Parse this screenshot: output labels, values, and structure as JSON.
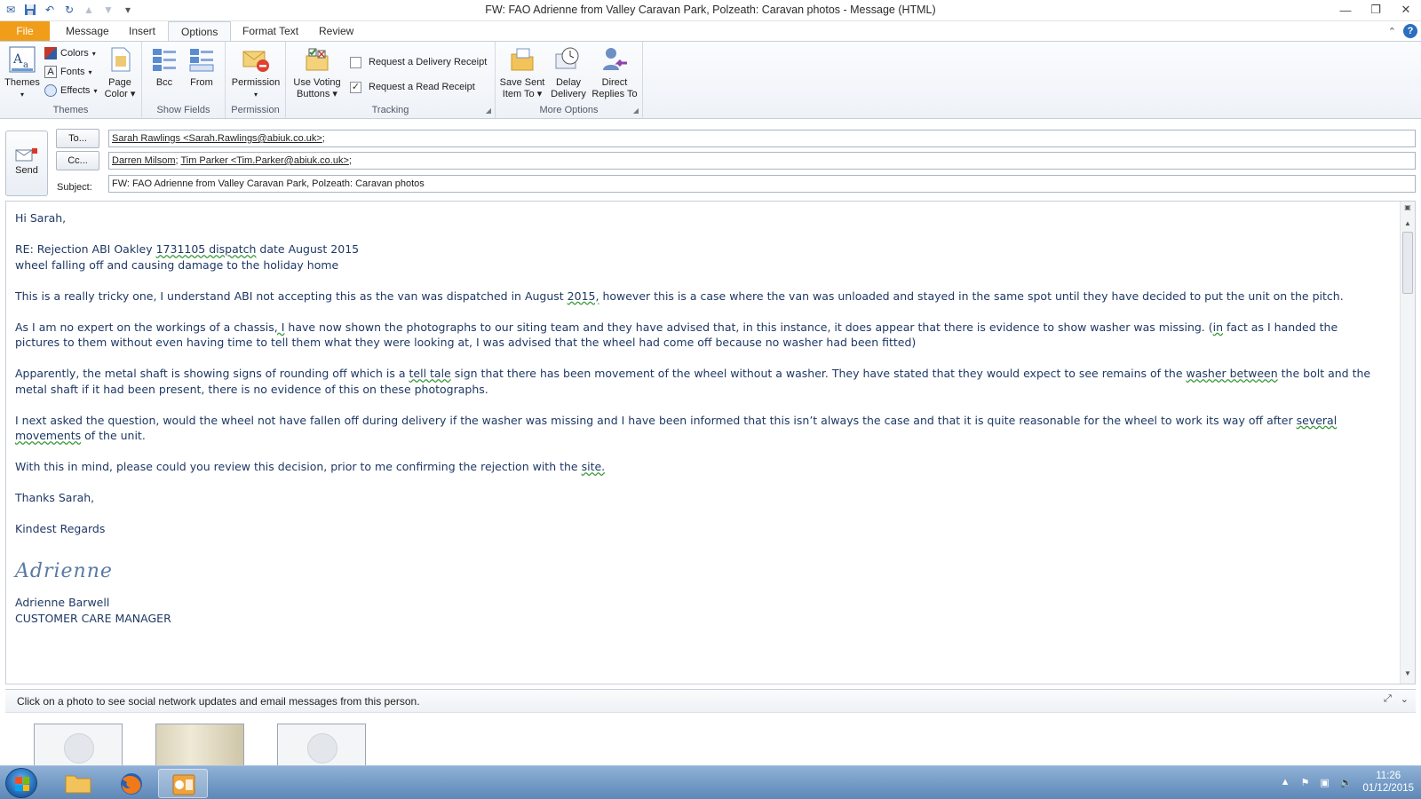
{
  "window": {
    "title": "FW: FAO Adrienne from Valley Caravan Park, Polzeath: Caravan photos  -  Message (HTML)"
  },
  "ribbon": {
    "tabs": [
      "File",
      "Message",
      "Insert",
      "Options",
      "Format Text",
      "Review"
    ],
    "active_tab": "Options",
    "themes_group": {
      "themes": "Themes",
      "colors": "Colors",
      "fonts": "Fonts",
      "effects": "Effects",
      "page_color": [
        "Page",
        "Color"
      ],
      "label": "Themes"
    },
    "show_fields_group": {
      "bcc": "Bcc",
      "from": "From",
      "label": "Show Fields"
    },
    "permission_group": {
      "permission": "Permission",
      "label": "Permission"
    },
    "tracking_group": {
      "use_voting": [
        "Use Voting",
        "Buttons"
      ],
      "delivery_receipt": "Request a Delivery Receipt",
      "delivery_checked": false,
      "read_receipt": "Request a Read Receipt",
      "read_checked": true,
      "label": "Tracking"
    },
    "more_options_group": {
      "save_sent": [
        "Save Sent",
        "Item To"
      ],
      "delay": [
        "Delay",
        "Delivery"
      ],
      "direct": [
        "Direct",
        "Replies To"
      ],
      "label": "More Options"
    }
  },
  "compose": {
    "send": "Send",
    "to_button": "To...",
    "cc_button": "Cc...",
    "subject_label": "Subject:",
    "to_value_1": "Sarah Rawlings <Sarah.Rawlings@abiuk.co.uk>",
    "to_value_sep": ";",
    "cc_value_1": "Darren Milsom",
    "cc_value_sep": "; ",
    "cc_value_2": "Tim Parker <Tim.Parker@abiuk.co.uk>",
    "cc_value_end": ";",
    "subject_value": "FW: FAO Adrienne from Valley Caravan Park, Polzeath: Caravan photos"
  },
  "body": {
    "greeting": "Hi Sarah,",
    "re_1": "RE: Rejection ABI Oakley ",
    "re_1_sq": "1731105  dispatch",
    "re_1_end": " date August 2015",
    "re_2": "wheel falling off and causing damage to the holiday home",
    "p1_a": "This is a really tricky one, I understand ABI not accepting this as the van was dispatched in August ",
    "p1_sq": "2015,",
    "p1_b": " however this is a case where the van was unloaded and stayed in the same spot until they have decided to put the unit on the pitch.",
    "p2_a": " As I am no expert on the workings of a chassis",
    "p2_sq": ",  I",
    "p2_b": " have now shown the photographs to our siting team and they have advised that, in this instance,  it does appear that there is evidence to show washer was missing.  (",
    "p2_sq2": "in",
    "p2_c": " fact as I handed the pictures to them without even having time to tell them what they were looking at, I was advised that the wheel had come off because no washer had been fitted)",
    "p3_a": "Apparently, the metal shaft is showing signs of rounding off which is a ",
    "p3_sq": "tell tale",
    "p3_b": " sign that there has been movement of the wheel without a washer.   They have stated that they would expect to see remains of the ",
    "p3_sq2": "washer  between",
    "p3_c": " the bolt and the metal shaft if it had been present, there is no evidence of this on these photographs.",
    "p4_a": "I next asked the question, would the wheel not have fallen off during delivery if the washer was missing and I have been informed that this isn’t always the case and that it is quite reasonable for the wheel to work its way off after ",
    "p4_sq": "several  movements",
    "p4_b": " of the unit.",
    "p5_a": "With this in mind, please could you review this decision,   prior to me confirming the rejection with the ",
    "p5_sq": "site.",
    "thanks": "Thanks Sarah,",
    "regards": "Kindest Regards",
    "signature": "Adrienne",
    "name": "Adrienne Barwell",
    "role": "CUSTOMER CARE MANAGER"
  },
  "people_pane": {
    "hint": "Click on a photo to see social network updates and email messages from this person."
  },
  "taskbar": {
    "time": "11:26",
    "date": "01/12/2015"
  },
  "colors": {
    "file_tab": "#f09d1a",
    "body_text": "#1f3864",
    "taskbar": "#5d88b8"
  }
}
